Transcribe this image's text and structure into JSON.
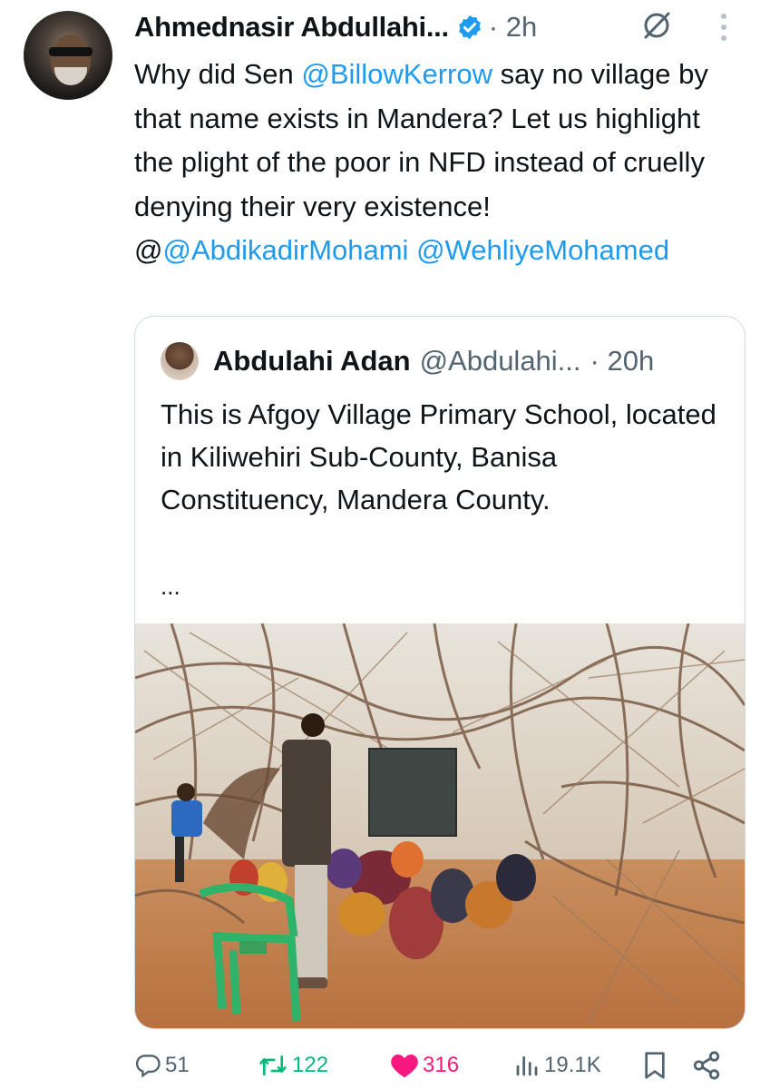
{
  "tweet": {
    "author_name": "Ahmednasir Abdullahi...",
    "time": "· 2h",
    "text_parts": {
      "p1": "Why did Sen ",
      "m1": "@BillowKerrow",
      "p2": " say no village by that name exists in Mandera? Let us highlight the plight of the poor in NFD instead of cruelly denying their very existence! @",
      "m2": "@AbdikadirMohami",
      "p3": " ",
      "m3": "@WehliyeMohamed"
    }
  },
  "quote": {
    "author_name": "Abdulahi Adan",
    "handle": "@Abdulahi...",
    "time": "· 20h",
    "text": "This is Afgoy Village Primary School, located in Kiliwehiri Sub-County, Banisa Constituency, Mandera County.",
    "ellipsis": "..."
  },
  "actions": {
    "replies": "51",
    "retweets": "122",
    "likes": "316",
    "views": "19.1K"
  },
  "colors": {
    "accent": "#1d9bf0",
    "retweet": "#00ba7c",
    "like": "#f91880",
    "muted": "#536471"
  },
  "icons": [
    "verified-badge-icon",
    "grok-icon",
    "more-options-icon",
    "reply-icon",
    "retweet-icon",
    "like-icon",
    "views-icon",
    "bookmark-icon",
    "share-icon"
  ]
}
